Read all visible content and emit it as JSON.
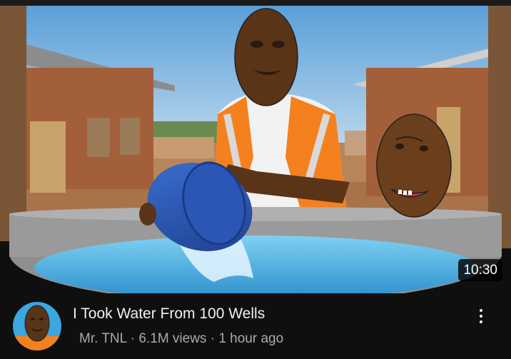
{
  "video": {
    "title": "I Took Water From 100 Wells",
    "duration": "10:30",
    "channel": "Mr. TNL",
    "views": "6.1M views",
    "separator": "·",
    "age": "1 hour ago"
  },
  "icons": {
    "more": "vertical-ellipsis-icon"
  },
  "colors": {
    "background": "#0f0f0f",
    "title": "#f1f1f1",
    "subtext": "#aaaaaa",
    "vest_orange": "#f5801e",
    "water": "#3aa7e0"
  }
}
